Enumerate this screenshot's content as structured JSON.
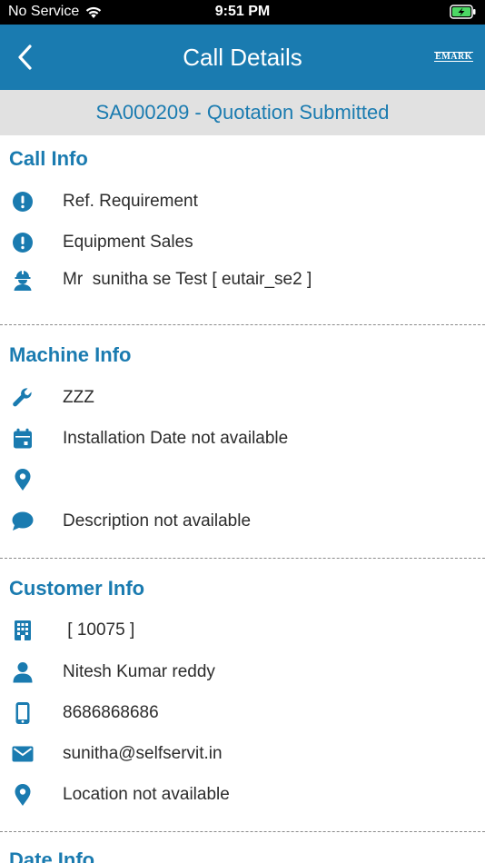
{
  "status_bar": {
    "carrier": "No Service",
    "time": "9:51 PM"
  },
  "nav": {
    "title": "Call Details",
    "brand": "EMARK"
  },
  "banner": {
    "text": "SA000209 - Quotation Submitted"
  },
  "call_info": {
    "title": "Call Info",
    "items": [
      {
        "icon": "exclamation-circle-icon",
        "text": "Ref. Requirement"
      },
      {
        "icon": "exclamation-circle-icon",
        "text": "Equipment Sales"
      },
      {
        "icon": "engineer-icon",
        "text": "Mr  sunitha se Test [ eutair_se2 ]"
      }
    ]
  },
  "machine_info": {
    "title": "Machine Info",
    "items": [
      {
        "icon": "wrench-icon",
        "text": "ZZZ"
      },
      {
        "icon": "calendar-icon",
        "text": "Installation Date not available"
      },
      {
        "icon": "map-pin-icon",
        "text": ""
      },
      {
        "icon": "chat-bubble-icon",
        "text": "Description not available"
      }
    ]
  },
  "customer_info": {
    "title": "Customer Info",
    "items": [
      {
        "icon": "building-icon",
        "text": " [ 10075 ]"
      },
      {
        "icon": "person-icon",
        "text": "Nitesh Kumar reddy"
      },
      {
        "icon": "mobile-phone-icon",
        "text": "8686868686"
      },
      {
        "icon": "envelope-icon",
        "text": "sunitha@selfservit.in"
      },
      {
        "icon": "map-pin-icon",
        "text": "Location not available"
      }
    ]
  },
  "date_info": {
    "title": "Date Info"
  },
  "colors": {
    "primary": "#1a7bb0",
    "banner_bg": "#e1e1e1",
    "text": "#2b2b2b"
  }
}
